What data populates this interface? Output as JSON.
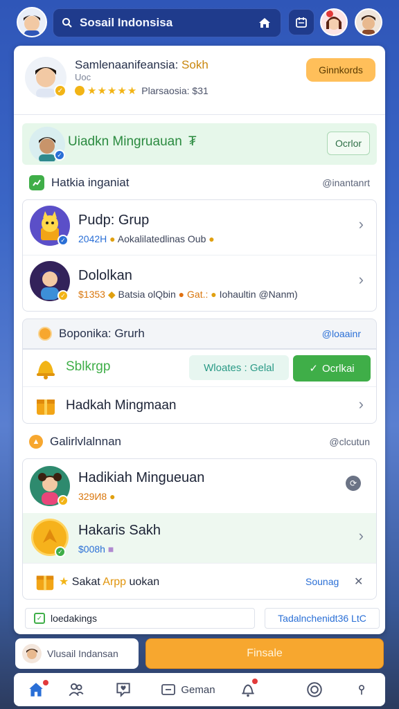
{
  "topbar": {
    "search_text": "Sosail Indonsisa"
  },
  "profile": {
    "name_prefix": "Samlenaanifeansia: ",
    "name_highlight": "Sokh",
    "subtitle": "Uoc",
    "rating_text": "Plarsaosia: $31",
    "action_label": "Ginnkords"
  },
  "highlight_row": {
    "title": "Uiadkn Mingruauan",
    "button_label": "Ocrlor"
  },
  "section1": {
    "label": "Hatkia inganiat",
    "right": "@inantanrt"
  },
  "groups": [
    {
      "title": "Pudp: Grup",
      "meta_blue": "2042H",
      "meta_rest": "Aokalilatedlinas Oub"
    },
    {
      "title": "Dololkan",
      "meta_orange": "$1353",
      "meta_rest": "Batsia olQbin",
      "meta_orange2": "Gat.:",
      "meta_rest2": "Iohaultin @Nanm)"
    }
  ],
  "section2": {
    "label": "Boponika: Grurh",
    "right": "@loaainr"
  },
  "group_row": {
    "title": "Sblkrgp",
    "pill": "Wloates : Gelal",
    "button": "Ocrlkai"
  },
  "mingguan_row": {
    "title": "Hadkah Mingmaan"
  },
  "section3": {
    "label": "Galirlvlalnnan",
    "right": "@clcutun"
  },
  "prizes": [
    {
      "title": "Hadikiah Minguеuan",
      "meta": "329И8"
    },
    {
      "title": "Hakaris Sakh",
      "meta": "$008h"
    }
  ],
  "sakat_row": {
    "prefix": "Sakat ",
    "mid": "Arpp",
    "suffix": " uokan",
    "right": "Sounag",
    "close": "✕"
  },
  "bottom_rows": {
    "left": "loedakings",
    "right": "Tadalnchenidt36 LtC"
  },
  "footer": {
    "input_text": "Vlusail Indansan",
    "cta": "Finsale"
  },
  "nav": {
    "center_label": "Geman"
  }
}
